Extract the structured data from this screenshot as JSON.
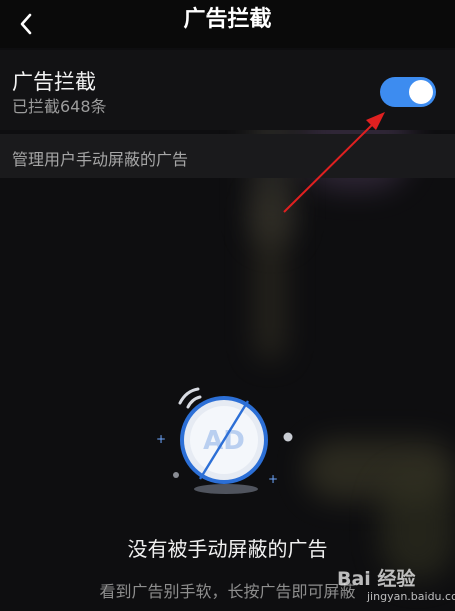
{
  "header": {
    "title": "广告拦截",
    "back_icon": "chevron-left-icon"
  },
  "ad_block": {
    "title": "广告拦截",
    "subtitle": "已拦截648条",
    "enabled": true,
    "toggle_color": "#3d8cf0"
  },
  "manage_section": {
    "label": "管理用户手动屏蔽的广告"
  },
  "empty_state": {
    "illustration": "ad-blocked-icon",
    "illustration_text": "AD",
    "title": "没有被手动屏蔽的广告",
    "hint": "看到广告别手软，长按广告即可屏蔽"
  },
  "annotation": {
    "arrow_color": "#e02020"
  },
  "watermark": {
    "text": "Bai 经验",
    "url": "jingyan.baidu.com"
  }
}
